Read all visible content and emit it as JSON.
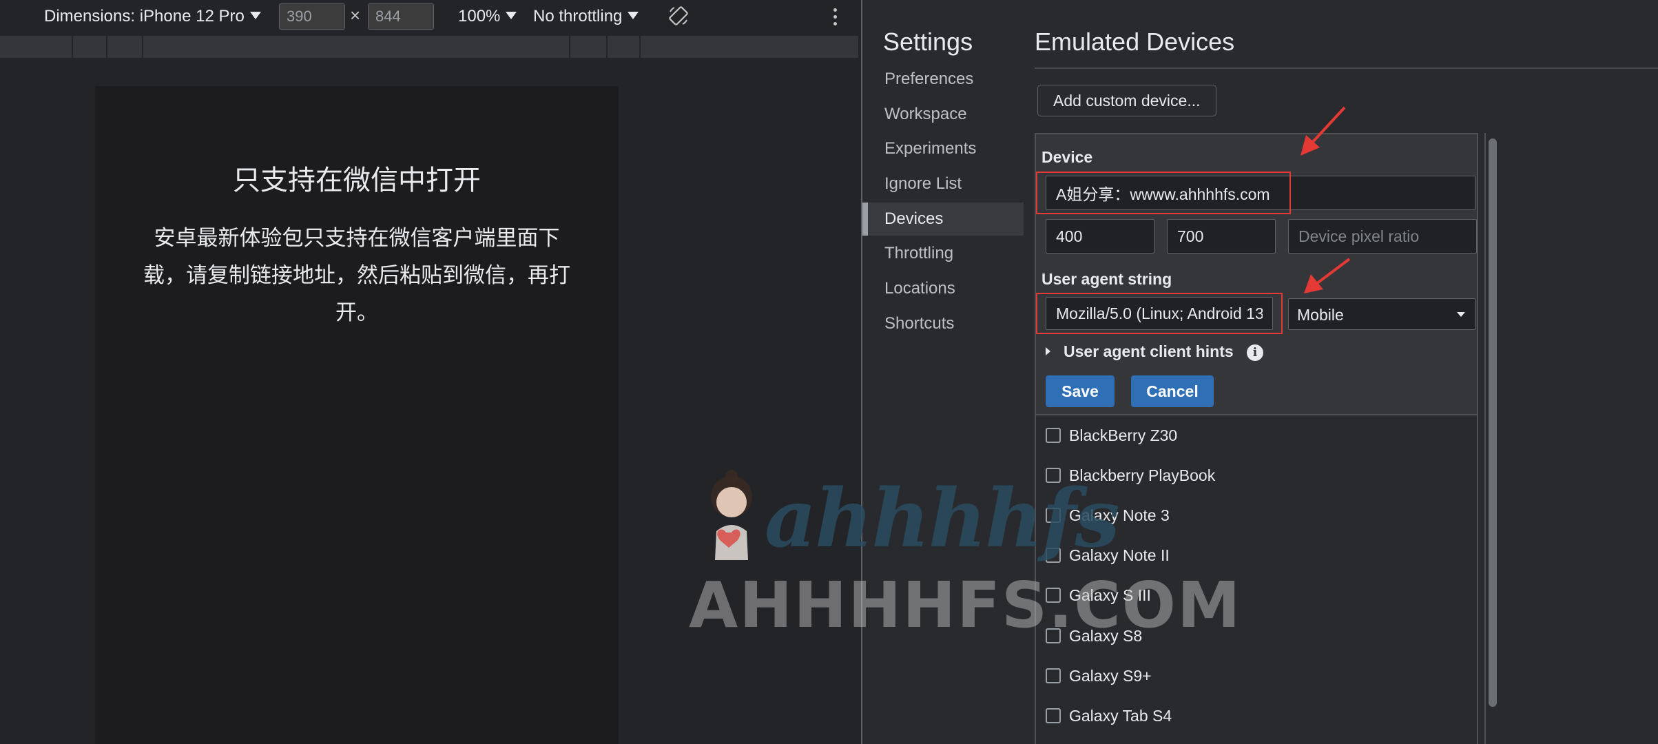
{
  "toolbar": {
    "dimensions_label": "Dimensions: iPhone 12 Pro",
    "width_value": "390",
    "height_value": "844",
    "times_symbol": "×",
    "zoom": "100%",
    "throttling": "No throttling",
    "rotate_icon": "rotate-icon",
    "more_icon": "more-vertical-icon"
  },
  "viewport": {
    "title": "只支持在微信中打开",
    "body": "安卓最新体验包只支持在微信客户端里面下载，请复制链接地址，然后粘贴到微信，再打开。"
  },
  "settings": {
    "title": "Settings",
    "nav": [
      {
        "label": "Preferences"
      },
      {
        "label": "Workspace"
      },
      {
        "label": "Experiments"
      },
      {
        "label": "Ignore List"
      },
      {
        "label": "Devices"
      },
      {
        "label": "Throttling"
      },
      {
        "label": "Locations"
      },
      {
        "label": "Shortcuts"
      }
    ],
    "active_nav": "Devices"
  },
  "emulated": {
    "title": "Emulated Devices",
    "add_button": "Add custom device...",
    "editor": {
      "device_label": "Device",
      "device_name": "A姐分享：wwww.ahhhhfs.com",
      "width": "400",
      "height": "700",
      "dpr_placeholder": "Device pixel ratio",
      "ua_label": "User agent string",
      "ua_value": "Mozilla/5.0 (Linux; Android 13",
      "ua_type": "Mobile",
      "hints_label": "User agent client hints",
      "info_icon_glyph": "i",
      "save": "Save",
      "cancel": "Cancel"
    },
    "devices": [
      {
        "label": "BlackBerry Z30"
      },
      {
        "label": "Blackberry PlayBook"
      },
      {
        "label": "Galaxy Note 3"
      },
      {
        "label": "Galaxy Note II"
      },
      {
        "label": "Galaxy S III"
      },
      {
        "label": "Galaxy S8"
      },
      {
        "label": "Galaxy S9+"
      },
      {
        "label": "Galaxy Tab S4"
      }
    ]
  },
  "watermark": {
    "script": "ahhhhfs",
    "text": "AHHHHFS.COM"
  },
  "colors": {
    "accent_button": "#2f6fb5",
    "annotation_red": "#e53935"
  }
}
